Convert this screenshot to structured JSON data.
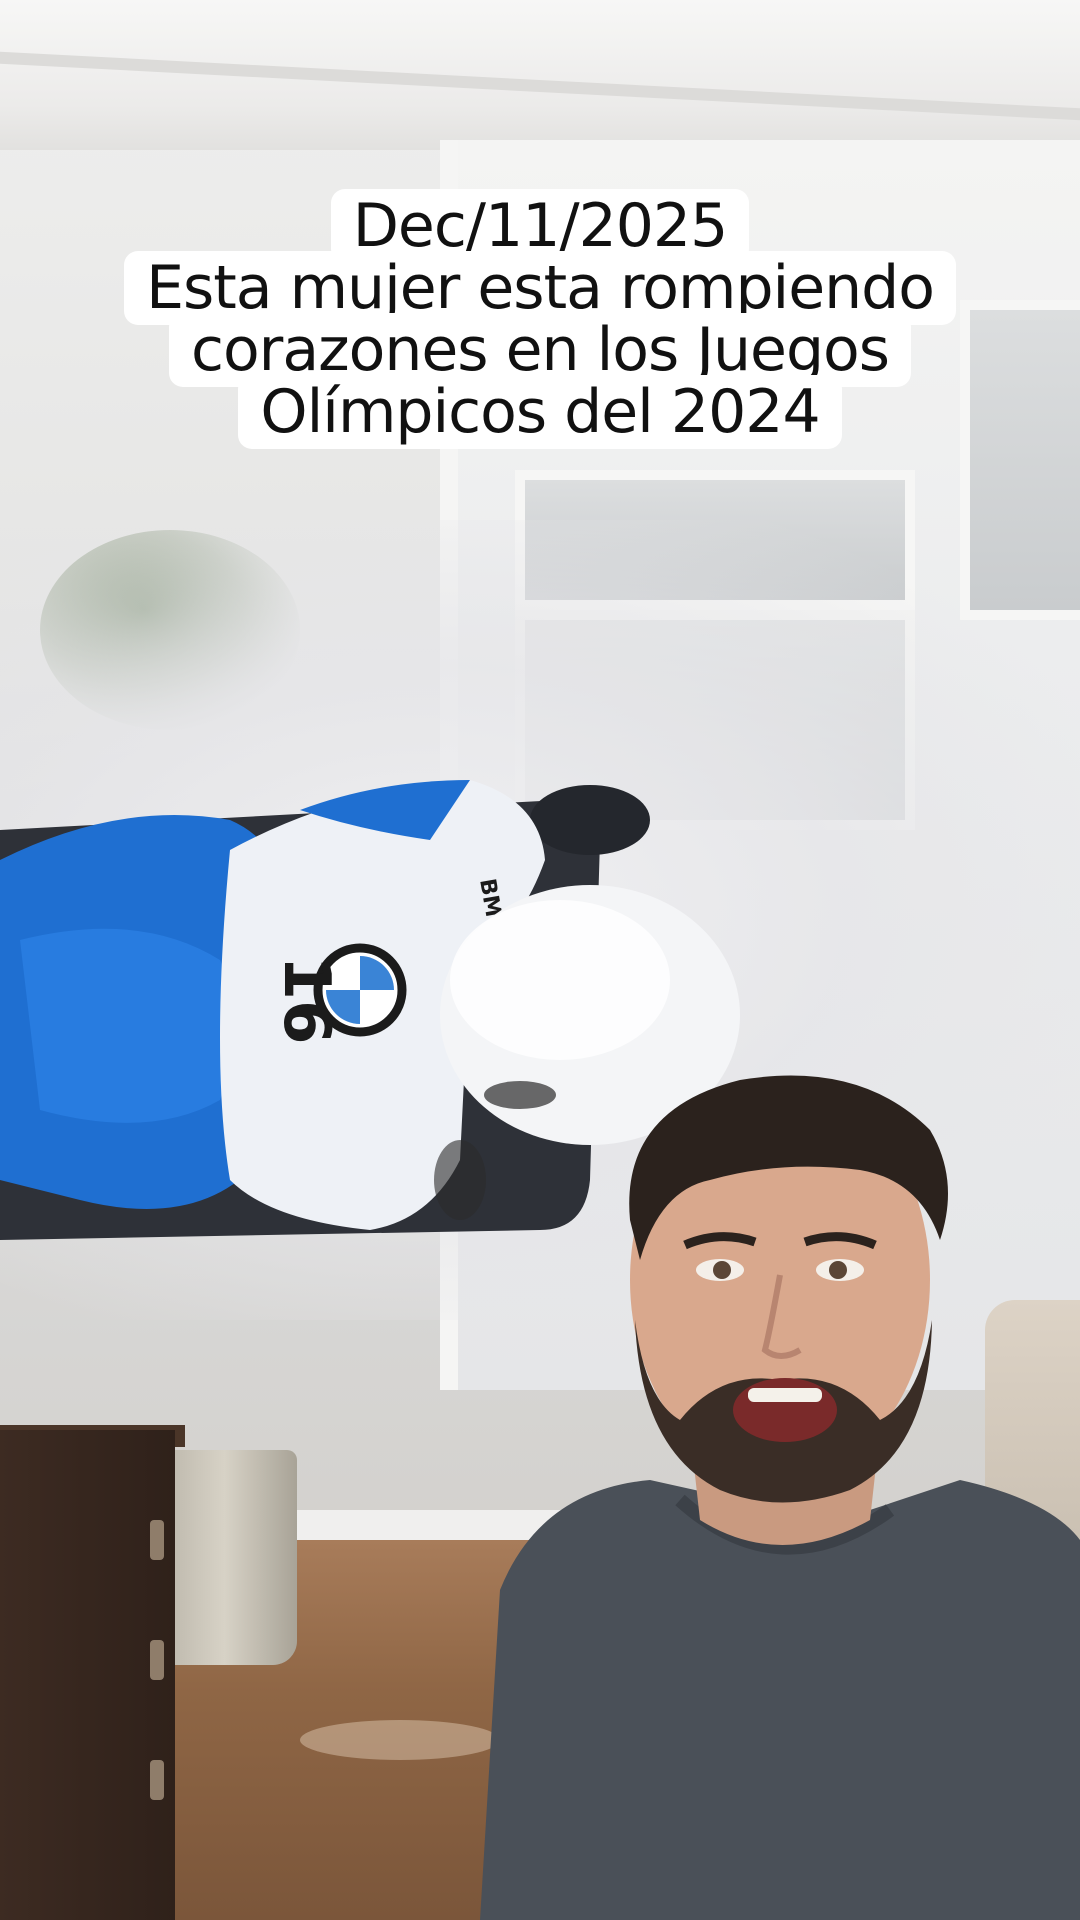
{
  "video": {
    "caption_lines": [
      "Dec/11/2025",
      "Esta mujer esta rompiendo",
      "corazones en los Juegos",
      "Olímpicos del 2024"
    ],
    "athlete_suit": {
      "number": "16",
      "brand_text": "BMW"
    }
  },
  "colors": {
    "caption_bg": "#ffffff",
    "caption_text": "#111111",
    "suit_blue": "#1f6fd1",
    "suit_white": "#eef1f6",
    "shirt_gray": "#4a5058"
  }
}
